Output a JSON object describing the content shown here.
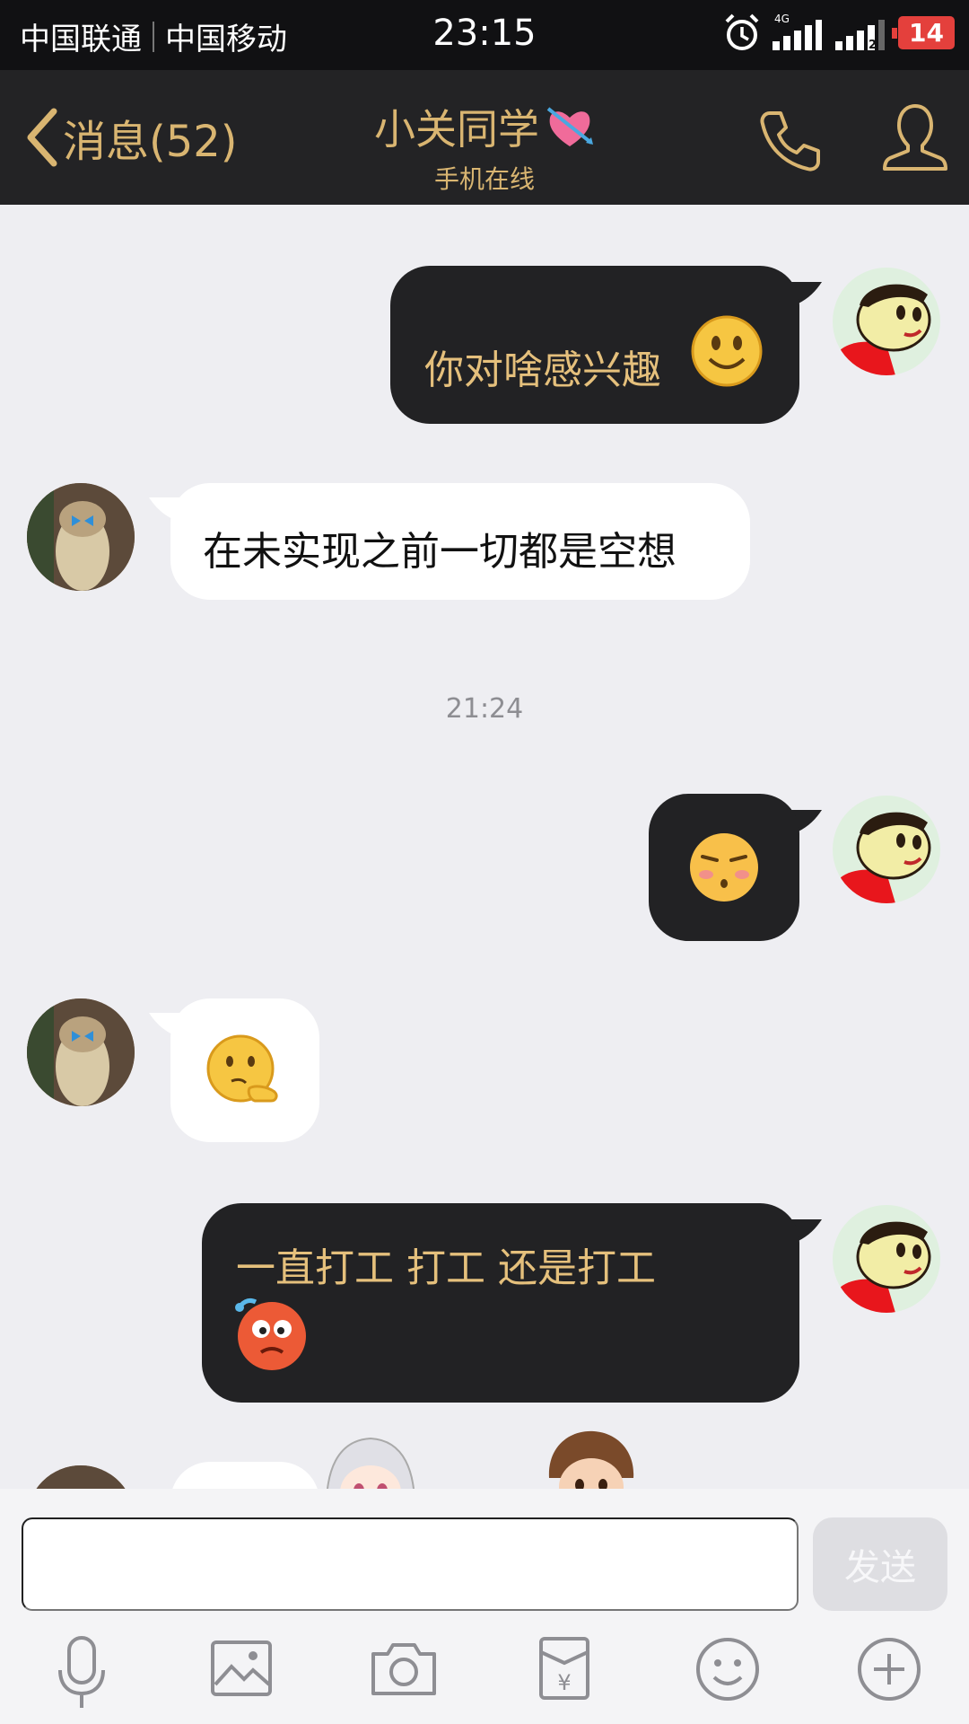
{
  "status_bar": {
    "carrier1": "中国联通",
    "carrier2": "中国移动",
    "time": "23:15",
    "network": "4G",
    "sim2_label": "2",
    "battery": "14",
    "icons": [
      "alarm-icon",
      "signal-icon",
      "signal-icon",
      "battery-icon"
    ]
  },
  "nav": {
    "back_label": "消息(52)",
    "title": "小关同学",
    "subtitle": "手机在线",
    "icons": [
      "back-chevron-icon",
      "heart-arrow-icon",
      "phone-icon",
      "profile-icon"
    ]
  },
  "messages": [
    {
      "side": "right",
      "type": "text",
      "text": "你对啥感兴趣",
      "emoji": "smile-emoji"
    },
    {
      "side": "left",
      "type": "text",
      "text": "在未实现之前一切都是空想"
    },
    {
      "type": "timestamp",
      "text": "21:24"
    },
    {
      "side": "right",
      "type": "emoji",
      "emoji": "pout-emoji"
    },
    {
      "side": "left",
      "type": "emoji",
      "emoji": "thinking-emoji"
    },
    {
      "side": "right",
      "type": "text",
      "line1": "一直打工 打工 还是打工",
      "emoji": "shocked-emoji"
    }
  ],
  "composer": {
    "send_label": "发送",
    "input_value": "",
    "tools": [
      "microphone-icon",
      "image-icon",
      "camera-icon",
      "red-packet-icon",
      "emoji-icon",
      "plus-icon"
    ]
  },
  "colors": {
    "nav_bg": "#232325",
    "accent_gold": "#d9b571",
    "dark_bubble": "#222224",
    "chat_bg": "#eeeef2",
    "battery_red": "#e4403c"
  }
}
